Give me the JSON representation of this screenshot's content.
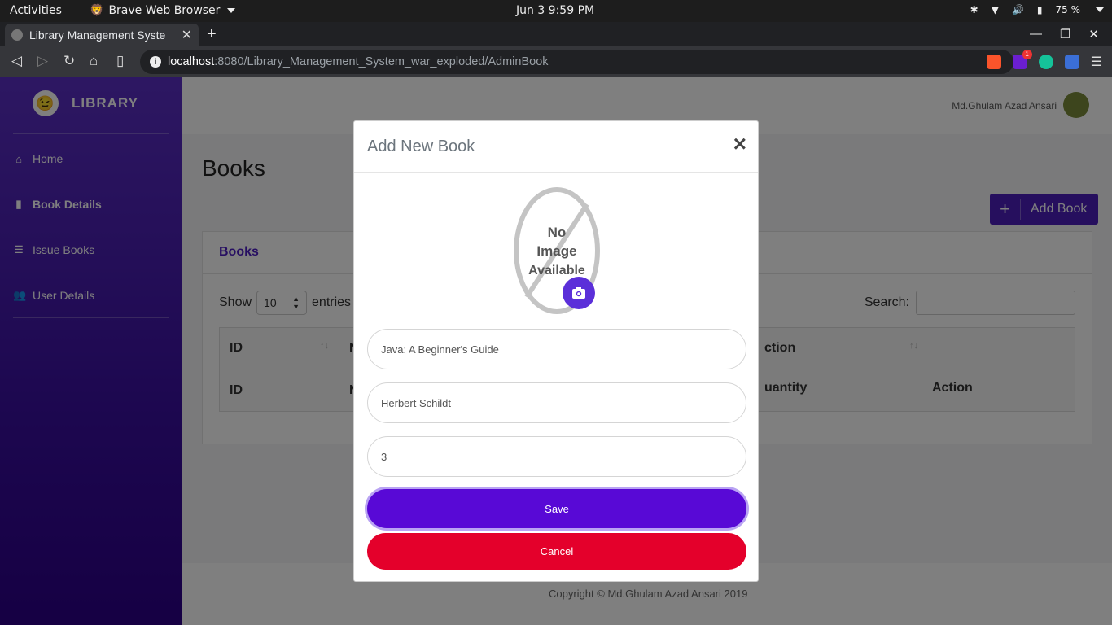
{
  "system_bar": {
    "activities": "Activities",
    "app_name": "Brave Web Browser",
    "clock": "Jun 3   9:59 PM",
    "battery": "75 %"
  },
  "browser": {
    "tab_title": "Library Management Syste",
    "url_host": "localhost",
    "url_rest": ":8080/Library_Management_System_war_exploded/AdminBook",
    "extension_badge": "1"
  },
  "sidebar": {
    "brand": "LIBRARY",
    "items": [
      {
        "label": "Home",
        "icon": "home-icon"
      },
      {
        "label": "Book Details",
        "icon": "book-icon"
      },
      {
        "label": "Issue Books",
        "icon": "list-icon"
      },
      {
        "label": "User Details",
        "icon": "users-icon"
      }
    ]
  },
  "header": {
    "user_name": "Md.Ghulam Azad Ansari"
  },
  "main": {
    "page_title": "Books",
    "add_button": "Add Book",
    "card_title": "Books",
    "show_label": "Show",
    "entries_value": "10",
    "entries_label": "entries",
    "search_label": "Search:",
    "columns_top": [
      "ID",
      "N",
      "ction"
    ],
    "columns_bottom": [
      "ID",
      "N",
      "uantity",
      "Action"
    ]
  },
  "footer": {
    "copyright": "Copyright © Md.Ghulam Azad Ansari 2019"
  },
  "modal": {
    "title": "Add New Book",
    "close": "×",
    "no_image_line1": "No",
    "no_image_line2": "Image",
    "no_image_line3": "Available",
    "book_name": "Java: A Beginner's Guide",
    "author": "Herbert Schildt",
    "quantity": "3",
    "save_label": "Save",
    "cancel_label": "Cancel"
  },
  "colors": {
    "primary": "#5809d6",
    "danger": "#e4002b",
    "sidebar": "#3a0fa0"
  }
}
